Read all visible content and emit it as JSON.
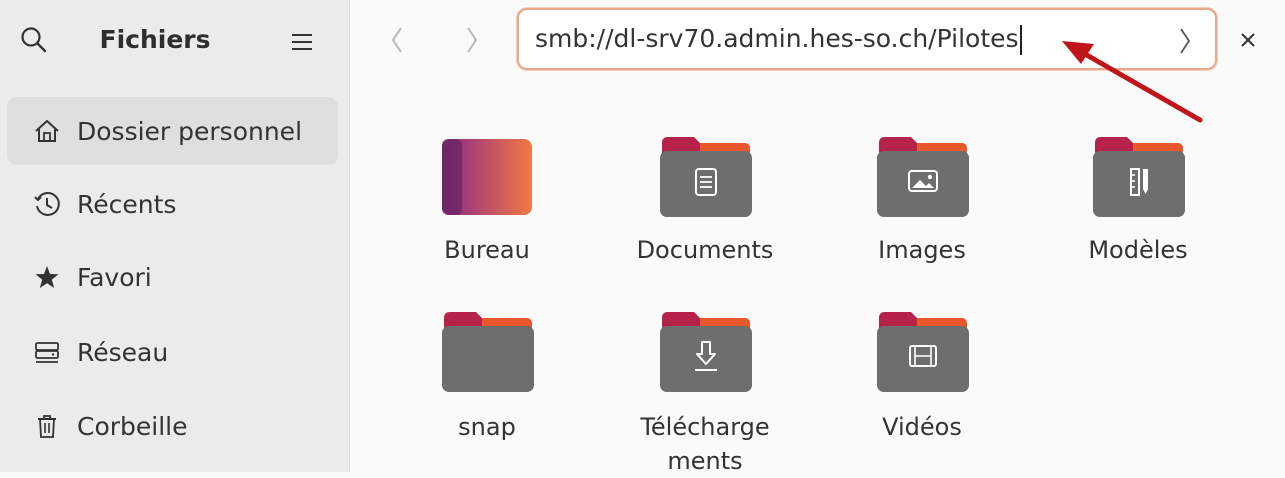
{
  "sidebar": {
    "title": "Fichiers",
    "items": [
      {
        "label": "Dossier personnel",
        "icon": "home-icon",
        "active": true
      },
      {
        "label": "Récents",
        "icon": "clock-icon",
        "active": false
      },
      {
        "label": "Favori",
        "icon": "star-icon",
        "active": false
      },
      {
        "label": "Réseau",
        "icon": "network-drive-icon",
        "active": false
      },
      {
        "label": "Corbeille",
        "icon": "trash-icon",
        "active": false
      }
    ]
  },
  "location": {
    "path": "smb://dl-srv70.admin.hes-so.ch/Pilotes"
  },
  "folders": [
    {
      "name": "Bureau",
      "icon": "desktop-folder-icon"
    },
    {
      "name": "Documents",
      "icon": "documents-folder-icon"
    },
    {
      "name": "Images",
      "icon": "pictures-folder-icon"
    },
    {
      "name": "Modèles",
      "icon": "templates-folder-icon"
    },
    {
      "name": "snap",
      "icon": "folder-icon"
    },
    {
      "name": "Télécharge\nments",
      "icon": "downloads-folder-icon"
    },
    {
      "name": "Vidéos",
      "icon": "videos-folder-icon"
    }
  ],
  "colors": {
    "accent": "#e8a98a",
    "folder_body": "#6e6e6e",
    "folder_tab": "#b7224a",
    "annotation_arrow": "#c0161b"
  }
}
